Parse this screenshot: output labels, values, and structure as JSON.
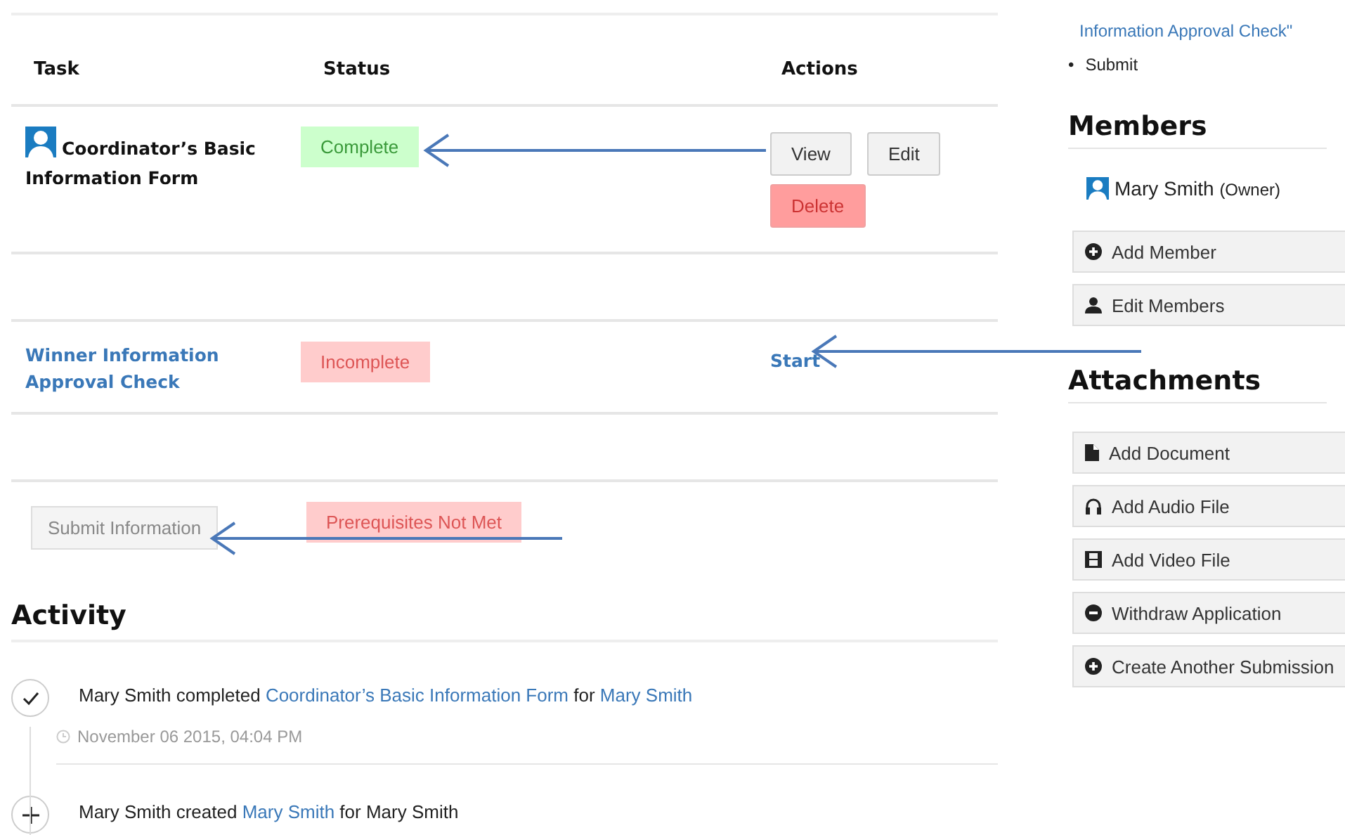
{
  "table": {
    "columns": [
      "Task",
      "Status",
      "Actions"
    ],
    "rows": [
      {
        "kind": "task",
        "task": "Coordinator’s Basic Information Form",
        "task_link": false,
        "avatar": true,
        "status": {
          "text": "Complete",
          "kind": "success"
        },
        "actions": [
          {
            "kind": "button",
            "label": "View"
          },
          {
            "kind": "button",
            "label": "Edit"
          },
          {
            "kind": "danger",
            "label": "Delete"
          }
        ]
      },
      {
        "kind": "spacer"
      },
      {
        "kind": "task",
        "task": "Winner Information Approval Check",
        "task_link": true,
        "avatar": false,
        "status": {
          "text": "Incomplete",
          "kind": "danger"
        },
        "actions": [
          {
            "kind": "link",
            "label": "Start"
          }
        ]
      },
      {
        "kind": "spacer"
      },
      {
        "kind": "submit",
        "button": {
          "label": "Submit Information",
          "disabled": true
        },
        "status": {
          "text": "Prerequisites Not Met",
          "kind": "danger"
        }
      }
    ]
  },
  "activity": {
    "title": "Activity",
    "items": [
      {
        "kind": "completed",
        "segments": [
          {
            "text": "Mary Smith completed ",
            "link": false
          },
          {
            "text": "Coordinator’s Basic Information Form",
            "link": true
          },
          {
            "text": " for ",
            "link": false
          },
          {
            "text": "Mary Smith",
            "link": true
          }
        ],
        "time": "November 06 2015, 04:04 PM"
      },
      {
        "kind": "created",
        "segments": [
          {
            "text": "Mary Smith created ",
            "link": false
          },
          {
            "text": "Mary Smith",
            "link": true
          },
          {
            "text": " for Mary Smith",
            "link": false
          }
        ]
      }
    ]
  },
  "sidebar": {
    "steps": [
      {
        "text": "Information Approval Check\"",
        "kind": "link"
      },
      {
        "text": "Submit",
        "kind": "bullet",
        "bullet": "•"
      }
    ],
    "members": {
      "title": "Members",
      "list": [
        {
          "name": "Mary Smith",
          "role": "(Owner)"
        }
      ],
      "buttons": [
        "Add Member",
        "Edit Members"
      ]
    },
    "attachments": {
      "title": "Attachments",
      "buttons": [
        "Add Document",
        "Add Audio File",
        "Add Video File",
        "Withdraw Application",
        "Create Another Submission"
      ]
    }
  }
}
